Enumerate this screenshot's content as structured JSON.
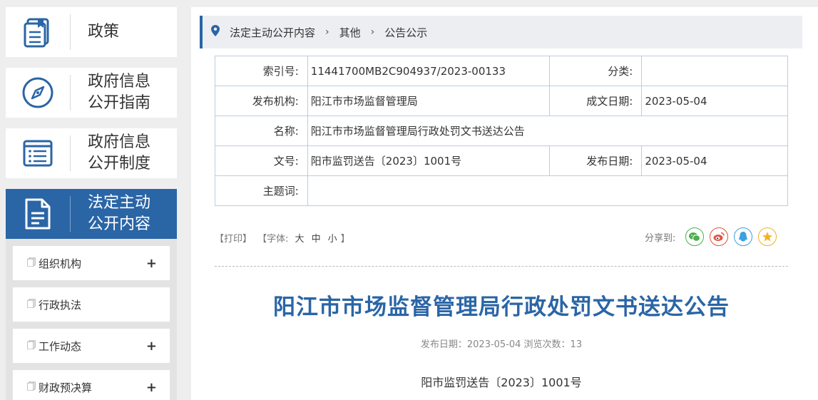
{
  "sidebar": {
    "nav": [
      {
        "label": "政策",
        "icon": "policy-document-icon"
      },
      {
        "label_l1": "政府信息",
        "label_l2": "公开指南",
        "icon": "compass-icon"
      },
      {
        "label_l1": "政府信息",
        "label_l2": "公开制度",
        "icon": "list-document-icon"
      },
      {
        "label_l1": "法定主动",
        "label_l2": "公开内容",
        "icon": "document-icon",
        "active": true
      }
    ],
    "sub_items": [
      {
        "label": "组织机构",
        "expand": "+"
      },
      {
        "label": "行政执法",
        "expand": ""
      },
      {
        "label": "工作动态",
        "expand": "+"
      },
      {
        "label": "财政预决算",
        "expand": "+"
      }
    ]
  },
  "breadcrumb": [
    "法定主动公开内容",
    "其他",
    "公告公示"
  ],
  "meta": {
    "index_label": "索引号:",
    "index_value": "11441700MB2C904937/2023-00133",
    "category_label": "分类:",
    "category_value": "",
    "publisher_label": "发布机构:",
    "publisher_value": "阳江市市场监督管理局",
    "created_label": "成文日期:",
    "created_value": "2023-05-04",
    "name_label": "名称:",
    "name_value": "阳江市市场监督管理局行政处罚文书送达公告",
    "docno_label": "文号:",
    "docno_value": "阳市监罚送告〔2023〕1001号",
    "published_label": "发布日期:",
    "published_value": "2023-05-04",
    "keywords_label": "主题词:",
    "keywords_value": ""
  },
  "tools": {
    "print": "【打印】",
    "font_prefix": "【字体:",
    "large": "大",
    "medium": "中",
    "small": "小",
    "font_suffix": "】",
    "share_label": "分享到:"
  },
  "article": {
    "title": "阳江市市场监督管理局行政处罚文书送达公告",
    "pubinfo": "发布日期：2023-05-04  浏览次数：13",
    "doc_number": "阳市监罚送告〔2023〕1001号"
  },
  "colors": {
    "brand": "#2a65a6",
    "wechat": "#4cae4c",
    "weibo": "#e6513b",
    "qq": "#3ba0e0",
    "qzone": "#f0b324"
  }
}
